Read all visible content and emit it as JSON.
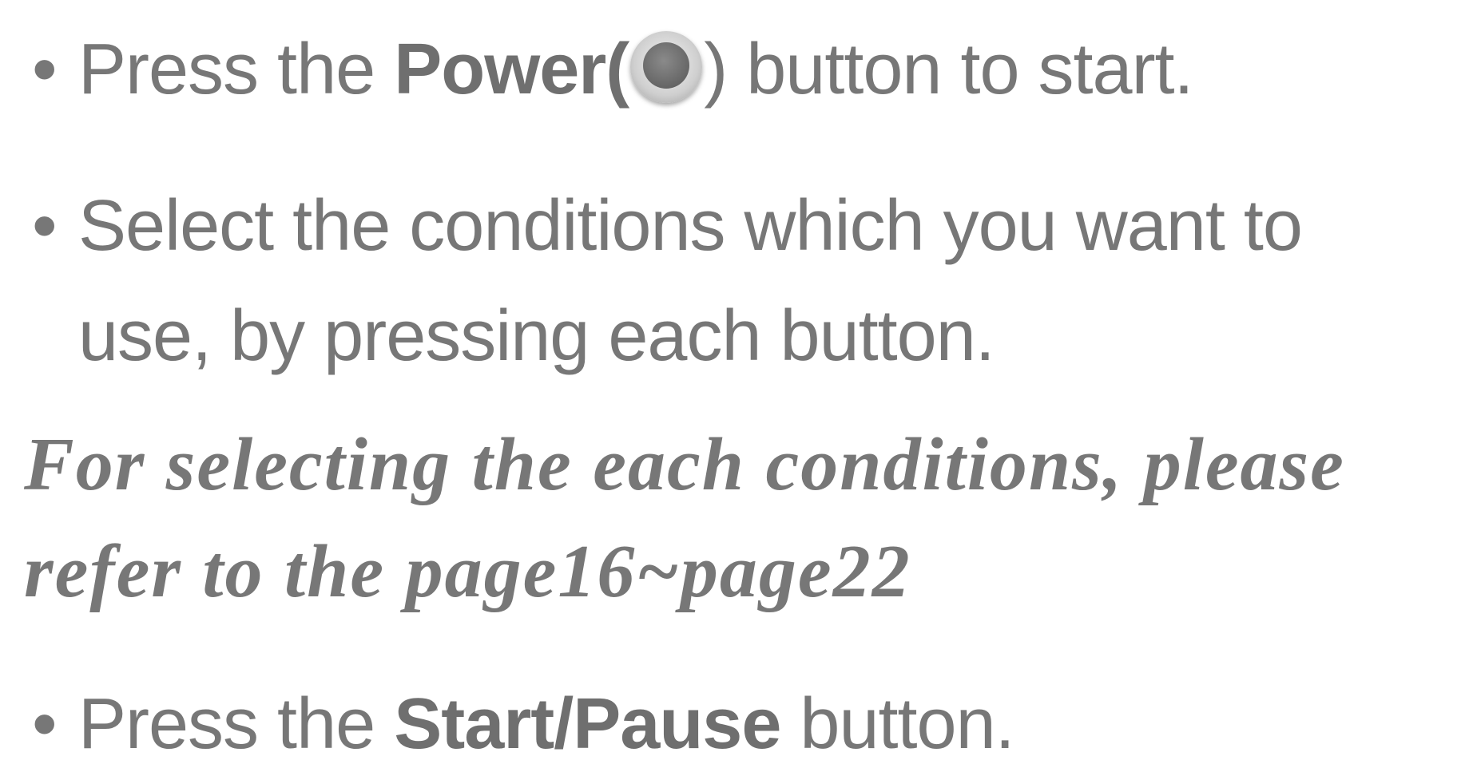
{
  "instructions": {
    "step1": {
      "bullet": "•",
      "before": "Press the ",
      "bold": "Power(",
      "icon": "power-button-icon",
      "after": ") button to start."
    },
    "step2": {
      "bullet": "•",
      "line1": "Select the conditions which you want to",
      "line2": "use, by pressing each button."
    },
    "note": {
      "line1": "For selecting the each conditions, please",
      "line2": "refer to the page16~page22"
    },
    "step3": {
      "bullet": "•",
      "before": "Press the ",
      "bold": "Start/Pause",
      "after": " button."
    }
  }
}
